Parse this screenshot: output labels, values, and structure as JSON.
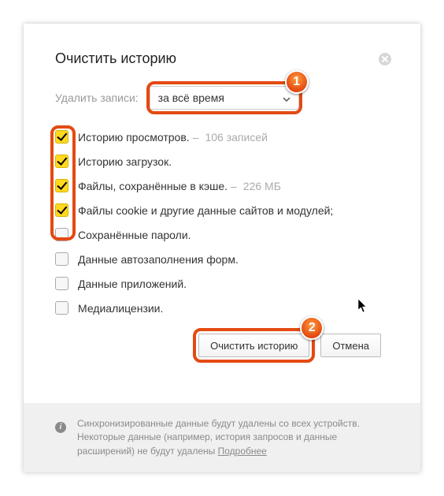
{
  "title": "Очистить историю",
  "range_label": "Удалить записи:",
  "range_value": "за всё время",
  "options": [
    {
      "label": "Историю просмотров.",
      "meta": "106 записей",
      "checked": true
    },
    {
      "label": "Историю загрузок.",
      "meta": "",
      "checked": true
    },
    {
      "label": "Файлы, сохранённые в кэше.",
      "meta": "226 МБ",
      "checked": true
    },
    {
      "label": "Файлы cookie и другие данные сайтов и модулей;",
      "meta": "",
      "checked": true
    },
    {
      "label": "Сохранённые пароли.",
      "meta": "",
      "checked": false
    },
    {
      "label": "Данные автозаполнения форм.",
      "meta": "",
      "checked": false
    },
    {
      "label": "Данные приложений.",
      "meta": "",
      "checked": false
    },
    {
      "label": "Медиалицензии.",
      "meta": "",
      "checked": false
    }
  ],
  "buttons": {
    "clear": "Очистить историю",
    "cancel": "Отмена"
  },
  "footer": {
    "text": "Синхронизированные данные будут удалены со всех устройств. Некоторые данные (например, история запросов и данные расширений) не будут удалены ",
    "link": "Подробнее"
  },
  "annotations": {
    "badge1": "1",
    "badge2": "2"
  }
}
